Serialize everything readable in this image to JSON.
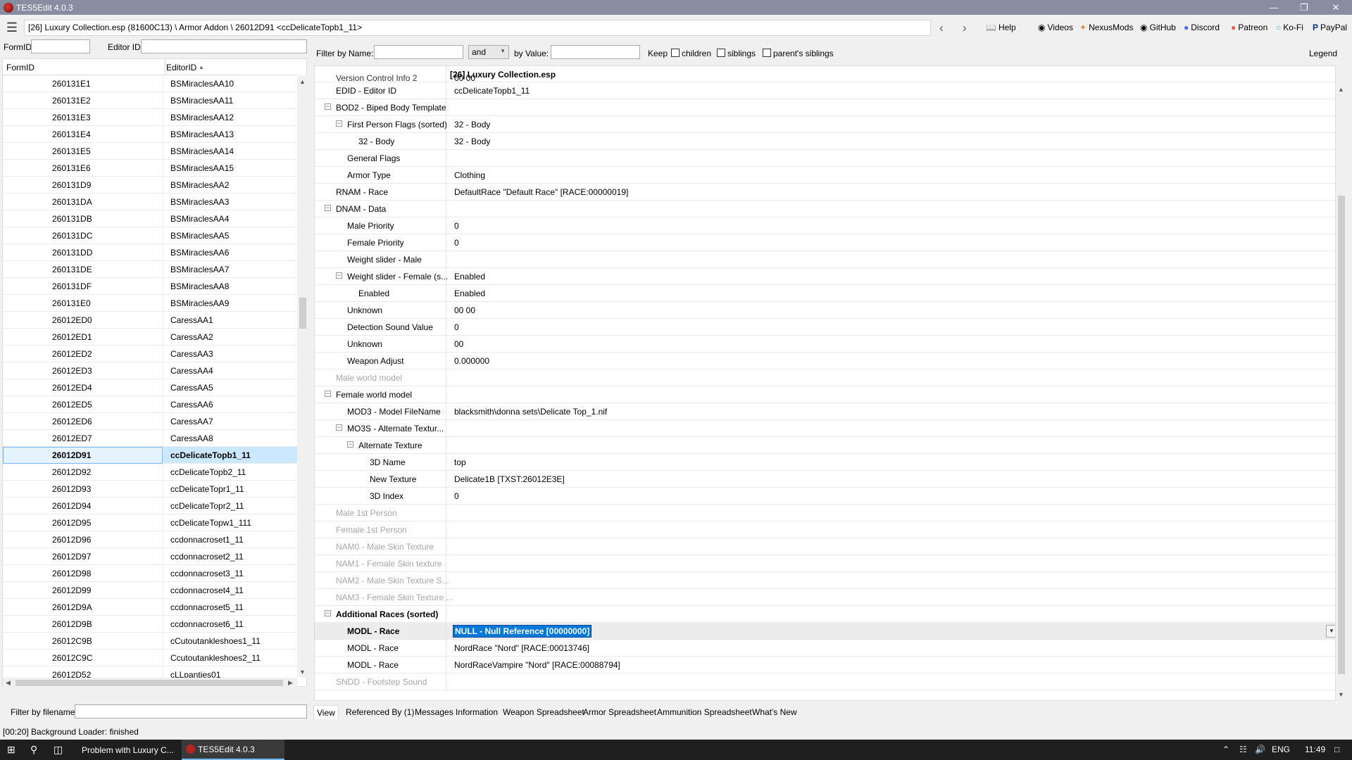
{
  "window": {
    "title": "TES5Edit 4.0.3"
  },
  "toolbar": {
    "path": "[26] Luxury Collection.esp (81600C13) \\ Armor Addon \\ 26012D91 <ccDelicateTopb1_11>",
    "links": [
      "Help",
      "Videos",
      "NexusMods",
      "GitHub",
      "Discord",
      "Patreon",
      "Ko-Fi",
      "PayPal"
    ]
  },
  "left": {
    "formid_label": "FormID",
    "editorid_label": "Editor ID",
    "col_formid": "FormID",
    "col_editorid": "EditorID",
    "filter_filename_label": "Filter by filename:",
    "rows": [
      {
        "fid": "260131E1",
        "eid": "BSMiraclesAA10"
      },
      {
        "fid": "260131E2",
        "eid": "BSMiraclesAA11"
      },
      {
        "fid": "260131E3",
        "eid": "BSMiraclesAA12"
      },
      {
        "fid": "260131E4",
        "eid": "BSMiraclesAA13"
      },
      {
        "fid": "260131E5",
        "eid": "BSMiraclesAA14"
      },
      {
        "fid": "260131E6",
        "eid": "BSMiraclesAA15"
      },
      {
        "fid": "260131D9",
        "eid": "BSMiraclesAA2"
      },
      {
        "fid": "260131DA",
        "eid": "BSMiraclesAA3"
      },
      {
        "fid": "260131DB",
        "eid": "BSMiraclesAA4"
      },
      {
        "fid": "260131DC",
        "eid": "BSMiraclesAA5"
      },
      {
        "fid": "260131DD",
        "eid": "BSMiraclesAA6"
      },
      {
        "fid": "260131DE",
        "eid": "BSMiraclesAA7"
      },
      {
        "fid": "260131DF",
        "eid": "BSMiraclesAA8"
      },
      {
        "fid": "260131E0",
        "eid": "BSMiraclesAA9"
      },
      {
        "fid": "26012ED0",
        "eid": "CaressAA1"
      },
      {
        "fid": "26012ED1",
        "eid": "CaressAA2"
      },
      {
        "fid": "26012ED2",
        "eid": "CaressAA3"
      },
      {
        "fid": "26012ED3",
        "eid": "CaressAA4"
      },
      {
        "fid": "26012ED4",
        "eid": "CaressAA5"
      },
      {
        "fid": "26012ED5",
        "eid": "CaressAA6"
      },
      {
        "fid": "26012ED6",
        "eid": "CaressAA7"
      },
      {
        "fid": "26012ED7",
        "eid": "CaressAA8"
      },
      {
        "fid": "26012D91",
        "eid": "ccDelicateTopb1_11",
        "selected": true
      },
      {
        "fid": "26012D92",
        "eid": "ccDelicateTopb2_11"
      },
      {
        "fid": "26012D93",
        "eid": "ccDelicateTopr1_11"
      },
      {
        "fid": "26012D94",
        "eid": "ccDelicateTopr2_11"
      },
      {
        "fid": "26012D95",
        "eid": "ccDelicateTopw1_111"
      },
      {
        "fid": "26012D96",
        "eid": "ccdonnacroset1_11"
      },
      {
        "fid": "26012D97",
        "eid": "ccdonnacroset2_11"
      },
      {
        "fid": "26012D98",
        "eid": "ccdonnacroset3_11"
      },
      {
        "fid": "26012D99",
        "eid": "ccdonnacroset4_11"
      },
      {
        "fid": "26012D9A",
        "eid": "ccdonnacroset5_11"
      },
      {
        "fid": "26012D9B",
        "eid": "ccdonnacroset6_11"
      },
      {
        "fid": "26012C9B",
        "eid": "cCutoutankleshoes1_11"
      },
      {
        "fid": "26012C9C",
        "eid": "Ccutoutankleshoes2_11"
      },
      {
        "fid": "26012D52",
        "eid": "cLLpanties01"
      }
    ]
  },
  "filter": {
    "by_name_label": "Filter by Name:",
    "op_value": "and",
    "by_value_label": "by Value:",
    "keep_label": "Keep",
    "children_label": "children",
    "siblings_label": "siblings",
    "parents_siblings_label": "parent's siblings",
    "legend_label": "Legend"
  },
  "detail": {
    "file_header": "[26] Luxury Collection.esp",
    "partial_top_label": "Version Control Info 2",
    "partial_top_value": "00 00",
    "rows": [
      {
        "label": "EDID - Editor ID",
        "value": "ccDelicateTopb1_11",
        "level": 0
      },
      {
        "label": "BOD2 - Biped Body Template",
        "value": "",
        "level": 0,
        "toggle": true
      },
      {
        "label": "First Person Flags (sorted)",
        "value": "32 - Body",
        "level": 1,
        "toggle": true
      },
      {
        "label": "32 - Body",
        "value": "32 - Body",
        "level": 2
      },
      {
        "label": "General Flags",
        "value": "",
        "level": 1
      },
      {
        "label": "Armor Type",
        "value": "Clothing",
        "level": 1
      },
      {
        "label": "RNAM - Race",
        "value": "DefaultRace \"Default Race\" [RACE:00000019]",
        "level": 0
      },
      {
        "label": "DNAM - Data",
        "value": "",
        "level": 0,
        "toggle": true
      },
      {
        "label": "Male Priority",
        "value": "0",
        "level": 1
      },
      {
        "label": "Female Priority",
        "value": "0",
        "level": 1
      },
      {
        "label": "Weight slider - Male",
        "value": "",
        "level": 1
      },
      {
        "label": "Weight slider - Female (s...",
        "value": "Enabled",
        "level": 1,
        "toggle": true
      },
      {
        "label": "Enabled",
        "value": "Enabled",
        "level": 2
      },
      {
        "label": "Unknown",
        "value": "00 00",
        "level": 1
      },
      {
        "label": "Detection Sound Value",
        "value": "0",
        "level": 1
      },
      {
        "label": "Unknown",
        "value": "00",
        "level": 1
      },
      {
        "label": "Weapon Adjust",
        "value": "0.000000",
        "level": 1
      },
      {
        "label": "Male world model",
        "value": "",
        "level": 0,
        "dim": true
      },
      {
        "label": "Female world model",
        "value": "",
        "level": 0,
        "toggle": true
      },
      {
        "label": "MOD3 - Model FileName",
        "value": "blacksmith\\donna sets\\Delicate Top_1.nif",
        "level": 1
      },
      {
        "label": "MO3S - Alternate Textur...",
        "value": "",
        "level": 1,
        "toggle": true
      },
      {
        "label": "Alternate Texture",
        "value": "",
        "level": 2,
        "toggle": true
      },
      {
        "label": "3D Name",
        "value": "top",
        "level": 3
      },
      {
        "label": "New Texture",
        "value": "Delicate1B [TXST:26012E3E]",
        "level": 3
      },
      {
        "label": "3D Index",
        "value": "0",
        "level": 3
      },
      {
        "label": "Male 1st Person",
        "value": "",
        "level": 0,
        "dim": true
      },
      {
        "label": "Female 1st Person",
        "value": "",
        "level": 0,
        "dim": true
      },
      {
        "label": "NAM0 - Male Skin Texture",
        "value": "",
        "level": 0,
        "dim": true
      },
      {
        "label": "NAM1 - Female Skin texture",
        "value": "",
        "level": 0,
        "dim": true
      },
      {
        "label": "NAM2 - Male Skin Texture S...",
        "value": "",
        "level": 0,
        "dim": true
      },
      {
        "label": "NAM3 - Female Skin Texture ...",
        "value": "",
        "level": 0,
        "dim": true
      },
      {
        "label": "Additional Races (sorted)",
        "value": "",
        "level": 0,
        "toggle": true,
        "bold": true
      },
      {
        "label": "MODL - Race",
        "value": "NULL - Null Reference [00000000]",
        "level": 1,
        "bold": true,
        "selected": true
      },
      {
        "label": "MODL - Race",
        "value": "NordRace \"Nord\" [RACE:00013746]",
        "level": 1
      },
      {
        "label": "MODL - Race",
        "value": "NordRaceVampire \"Nord\" [RACE:00088794]",
        "level": 1
      },
      {
        "label": "SNDD - Footstep Sound",
        "value": "",
        "level": 0,
        "dim": true
      }
    ]
  },
  "tabs": [
    "View",
    "Referenced By (1)",
    "Messages",
    "Information",
    "Weapon Spreadsheet",
    "Armor Spreadsheet",
    "Ammunition Spreadsheet",
    "What's New"
  ],
  "status": {
    "text": "[00:20] Background Loader: finished"
  },
  "taskbar": {
    "apps": [
      "Problem with Luxury C...",
      "TES5Edit 4.0.3"
    ],
    "lang": "ENG",
    "time": "11:49"
  }
}
